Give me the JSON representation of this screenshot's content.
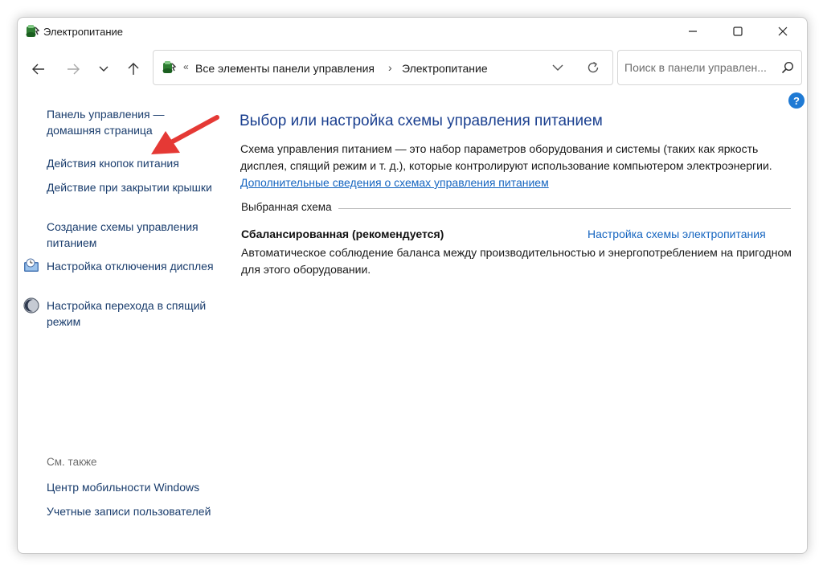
{
  "window": {
    "title": "Электропитание"
  },
  "nav": {
    "breadcrumb_sep": "«",
    "crumb1": "Все элементы панели управления",
    "crumb_chevron": "›",
    "crumb2": "Электропитание"
  },
  "search": {
    "placeholder": "Поиск в панели управлен..."
  },
  "help": {
    "label": "?"
  },
  "sidebar": {
    "items": [
      "Панель управления — домашняя страница",
      "Действия кнопок питания",
      "Действие при закрытии крышки",
      "Создание схемы управления питанием",
      "Настройка отключения дисплея",
      "Настройка перехода в спящий режим"
    ],
    "see_also_label": "См. также",
    "see_also": [
      "Центр мобильности Windows",
      "Учетные записи пользователей"
    ]
  },
  "main": {
    "title": "Выбор или настройка схемы управления питанием",
    "description": "Схема управления питанием — это набор параметров оборудования и системы (таких как яркость дисплея, спящий режим и т. д.), которые контролируют использование компьютером электроэнергии.",
    "description_link": "Дополнительные сведения о схемах управления питанием",
    "selected_label": "Выбранная схема",
    "scheme_name": "Сбалансированная (рекомендуется)",
    "scheme_link": "Настройка схемы электропитания",
    "scheme_description": "Автоматическое соблюдение баланса между производительностью и энергопотреблением на пригодном для этого оборудовании."
  },
  "colors": {
    "title_blue": "#1a3f8f",
    "link_blue": "#1565c0",
    "nav_link": "#1a3d6d",
    "arrow_red": "#e53935"
  },
  "icons": {
    "app": "power-options-icon",
    "display": "display-off-icon",
    "sleep": "sleep-moon-icon"
  }
}
